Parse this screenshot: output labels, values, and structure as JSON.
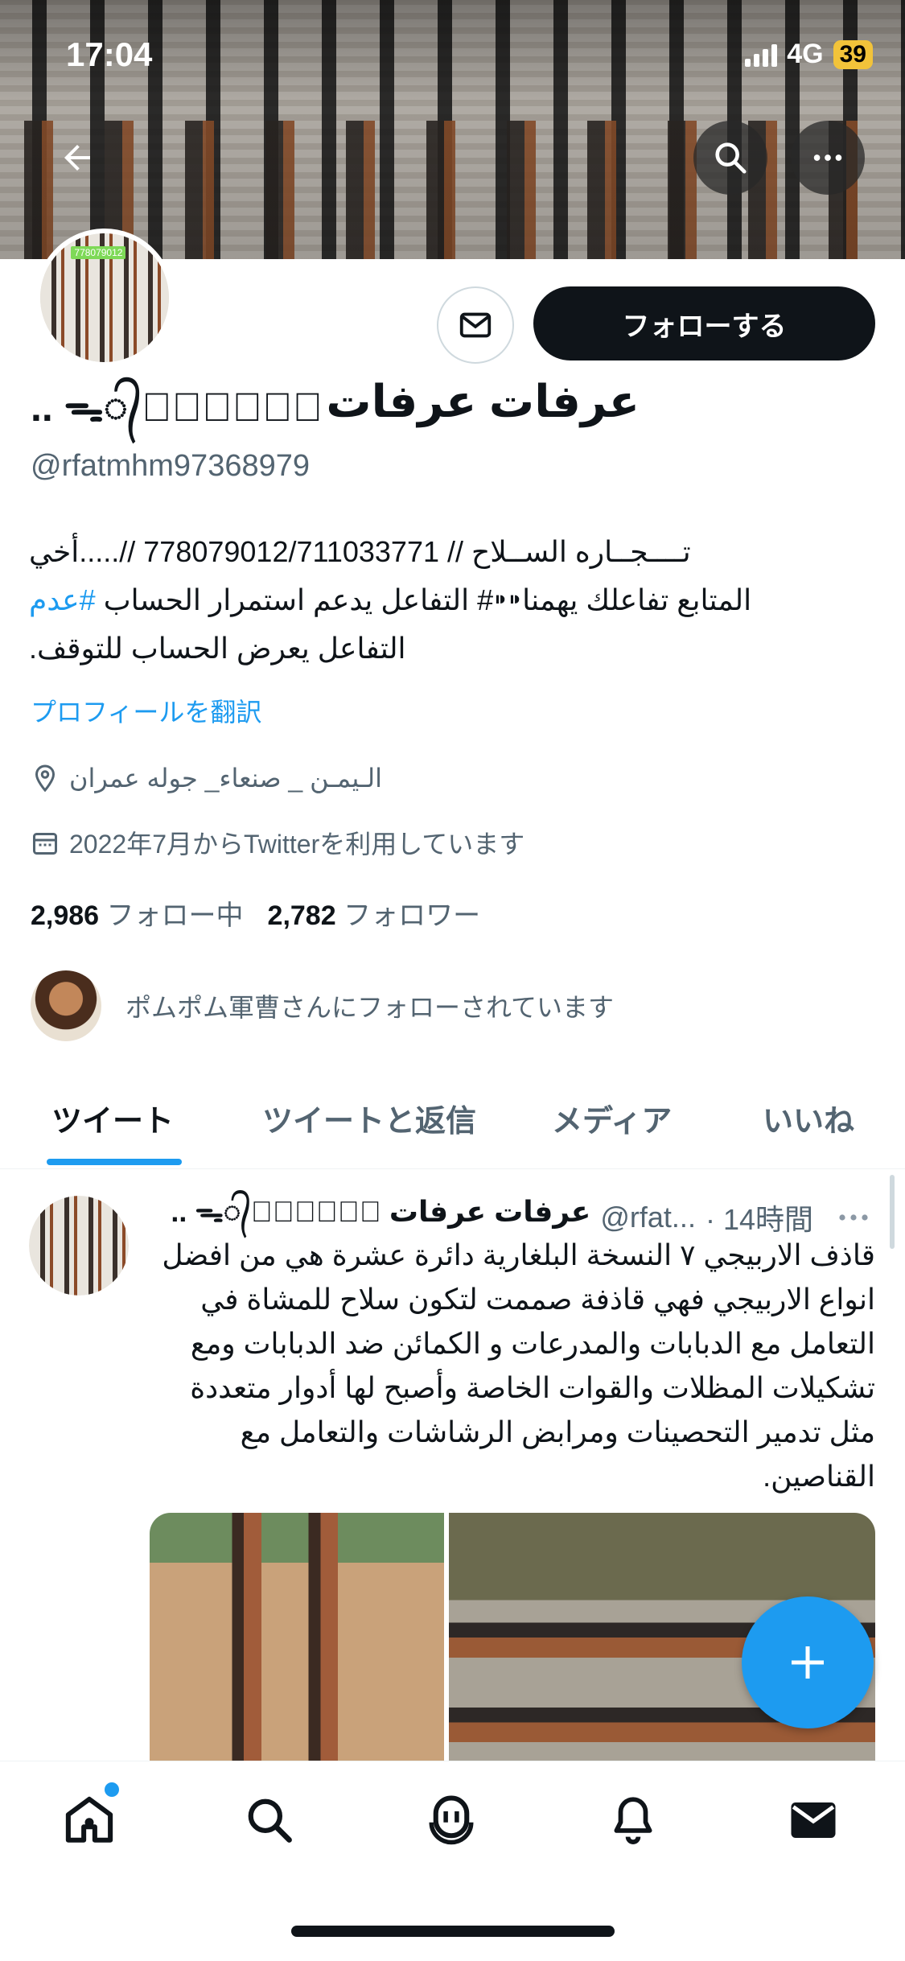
{
  "status_bar": {
    "time": "17:04",
    "network": "4G",
    "battery": "39"
  },
  "profile": {
    "display_name": "عرفات عرفات",
    "name_decoration": ".. ᯓ᭄ᬊ᭄᭄ᷟᬼᬼ",
    "handle": "@rfatmhm97368979",
    "bio_line1": "تــــجــاره الســلاح // 778079012/711033771 //.....أخي",
    "bio_line2_tag": "#عدم",
    "bio_line2_text": "المتابع تفاعلك يهمنا⁍⁍# التفاعل يدعم استمرار الحساب ",
    "bio_line3": "التفاعل يعرض الحساب للتوقف.",
    "translate_label": "プロフィールを翻訳",
    "location": "الـيمـن _ صنعاء_ جوله عمران",
    "joined": "2022年7月からTwitterを利用しています",
    "following_count": "2,986",
    "following_label": "フォロー中",
    "followers_count": "2,782",
    "followers_label": "フォロワー",
    "followed_by": "ポムポム軍曹さんにフォローされています",
    "avatar_tag": "778079012"
  },
  "buttons": {
    "follow": "フォローする"
  },
  "tabs": [
    {
      "label": "ツイート"
    },
    {
      "label": "ツイートと返信"
    },
    {
      "label": "メディア"
    },
    {
      "label": "いいね"
    }
  ],
  "tweet": {
    "name": "عرفات عرفات ᯓ᭄ᬊ᭄᭄ᷟᬼᬼ ..",
    "handle": "@rfat...",
    "time": "· 14時間",
    "text": "قاذف الاربيجي ٧ النسخة البلغارية دائرة عشرة هي من افضل انواع الاربيجي فهي قاذفة صممت لتكون سلاح للمشاة في التعامل مع الدبابات والمدرعات و الكمائن ضد الدبابات ومع تشكيلات المظلات والقوات الخاصة وأصبح لها أدوار متعددة مثل تدمير التحصينات ومرابض الرشاشات والتعامل مع القناصين."
  },
  "colors": {
    "accent": "#1d9bf0",
    "text": "#0f1419",
    "secondary": "#536471"
  }
}
